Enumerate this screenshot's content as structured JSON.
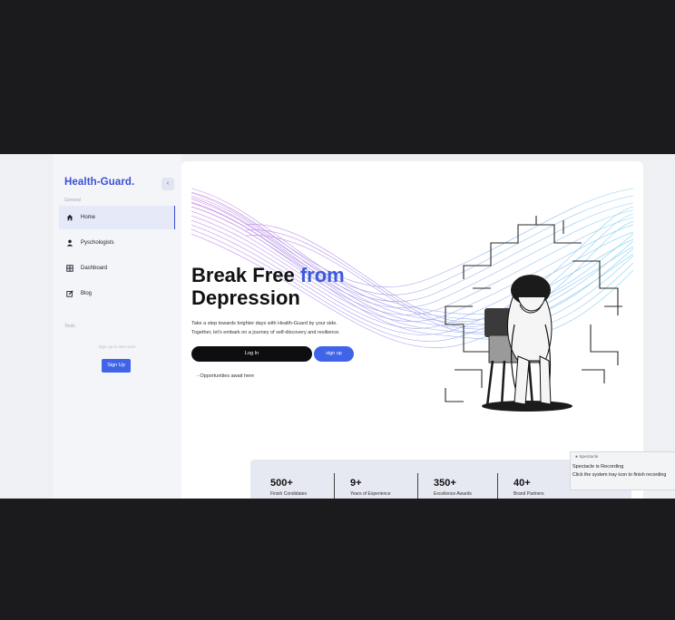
{
  "sidebar": {
    "logo": "Health-Guard.",
    "collapse_icon": "chevron-left-icon",
    "section_general": "General",
    "items": [
      {
        "label": "Home",
        "icon": "home-icon",
        "active": true
      },
      {
        "label": "Pyschologists",
        "icon": "user-icon",
        "active": false
      },
      {
        "label": "Dashboard",
        "icon": "grid-icon",
        "active": false
      },
      {
        "label": "Blog",
        "icon": "edit-icon",
        "active": false
      }
    ],
    "section_tools": "Tools",
    "signup_hint": "Sign Up to see more",
    "signup_button": "Sign Up"
  },
  "hero": {
    "title_line1": "Break Free ",
    "title_accent": "from",
    "title_line2": "Depression",
    "subtitle_line1": "Take a step towards brighter days with Health-Guard by your side.",
    "subtitle_line2": "Together, let's embark on a journey of self-discovery and resilience.",
    "login_label": "Log In",
    "signup_label": "sign up",
    "opportunities": "- Opportunities await here"
  },
  "stats": [
    {
      "value": "500+",
      "label": "Finish Condidates"
    },
    {
      "value": "9+",
      "label": "Years of Experience"
    },
    {
      "value": "350+",
      "label": "Excellence Awards"
    },
    {
      "value": "40+",
      "label": "Brand Partners"
    }
  ],
  "notification": {
    "app": "● Spectacle",
    "title": "Spectacle is Recording",
    "body": "Click the system tray icon to finish recording"
  },
  "colors": {
    "accent": "#3b5bdb",
    "button": "#3f64e8",
    "dark": "#0e0e10"
  }
}
